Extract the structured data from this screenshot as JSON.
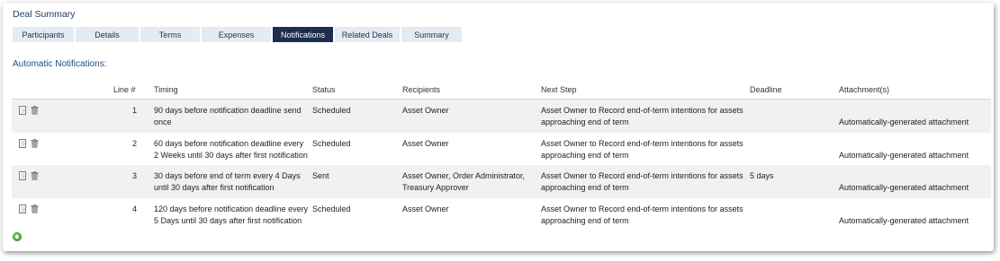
{
  "page_title": "Deal Summary",
  "tabs": [
    {
      "label": "Participants",
      "active": false
    },
    {
      "label": "Details",
      "active": false
    },
    {
      "label": "Terms",
      "active": false
    },
    {
      "label": "Expenses",
      "active": false
    },
    {
      "label": "Notifications",
      "active": true
    },
    {
      "label": "Related Deals",
      "active": false
    },
    {
      "label": "Summary",
      "active": false
    }
  ],
  "section_title": "Automatic Notifications:",
  "table": {
    "headers": {
      "line": "Line #",
      "timing": "Timing",
      "status": "Status",
      "recipients": "Recipients",
      "next_step": "Next Step",
      "deadline": "Deadline",
      "attachments": "Attachment(s)"
    },
    "rows": [
      {
        "line": "1",
        "timing": "90 days before notification deadline send once",
        "status": "Scheduled",
        "recipients": "Asset Owner",
        "next_step": "Asset Owner to Record end-of-term intentions for assets approaching end of term",
        "deadline": "",
        "attachment": "Automatically-generated attachment"
      },
      {
        "line": "2",
        "timing": "60 days before notification deadline every 2 Weeks until 30 days after first notification",
        "status": "Scheduled",
        "recipients": "Asset Owner",
        "next_step": "Asset Owner to Record end-of-term intentions for assets approaching end of term",
        "deadline": "",
        "attachment": "Automatically-generated attachment"
      },
      {
        "line": "3",
        "timing": "30 days before end of term every 4 Days until 30 days after first notification",
        "status": "Sent",
        "recipients": "Asset Owner, Order Administrator, Treasury Approver",
        "next_step": "Asset Owner to Record end-of-term intentions for assets approaching end of term",
        "deadline": "5 days",
        "attachment": "Automatically-generated attachment"
      },
      {
        "line": "4",
        "timing": "120 days before notification deadline every 5 Days until 30 days after first notification",
        "status": "Scheduled",
        "recipients": "Asset Owner",
        "next_step": "Asset Owner to Record end-of-term intentions for assets approaching end of term",
        "deadline": "",
        "attachment": "Automatically-generated attachment"
      }
    ]
  },
  "icons": {
    "edit": "edit-notification-icon",
    "delete": "trash-icon",
    "add": "add-circle-icon"
  },
  "colors": {
    "active_tab_bg": "#1b2f4d",
    "tab_bg": "#e4ebf2",
    "title": "#1f3b5f",
    "section_title": "#1f4e7a",
    "row_alt": "#f1f1f1",
    "add_green": "#3e9a2b"
  }
}
